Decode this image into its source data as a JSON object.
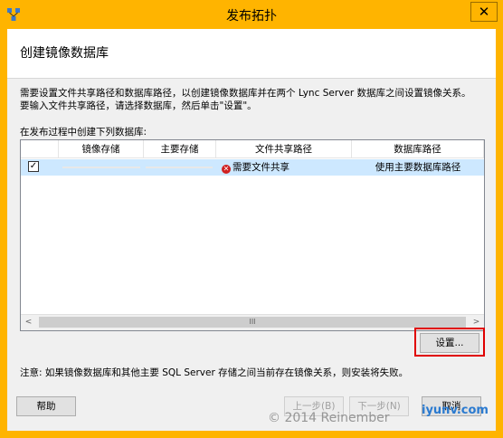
{
  "window": {
    "title": "发布拓扑",
    "close_glyph": "✕",
    "app_icon": "topology-app-icon",
    "accent": "#ffb400"
  },
  "page": {
    "title": "创建镜像数据库"
  },
  "description": {
    "line1": "需要设置文件共享路径和数据库路径，以创建镜像数据库并在两个 Lync Server 数据库之间设置镜像关系。",
    "line2": "要输入文件共享路径，请选择数据库，然后单击\"设置\"。"
  },
  "list": {
    "caption": "在发布过程中创建下列数据库:",
    "columns": [
      "",
      "镜像存储",
      "主要存储",
      "文件共享路径",
      "数据库路径"
    ],
    "rows": [
      {
        "checked": true,
        "check_glyph": "✓",
        "mirror_store": "",
        "primary_store": "",
        "share_status": "需要文件共享",
        "share_icon": "error-icon",
        "db_path": "使用主要数据库路径"
      }
    ],
    "scroll_left": "<",
    "scroll_right": ">",
    "scroll_thumb": "III"
  },
  "buttons": {
    "settings": "设置...",
    "help": "帮助",
    "back": "上一步(B)",
    "next": "下一步(N)",
    "cancel": "取消"
  },
  "note": "注意: 如果镜像数据库和其他主要 SQL Server 存储之间当前存在镜像关系，则安装将失败。",
  "watermark": {
    "text": "© 2014 Reinember",
    "site": "iyunv.com"
  }
}
